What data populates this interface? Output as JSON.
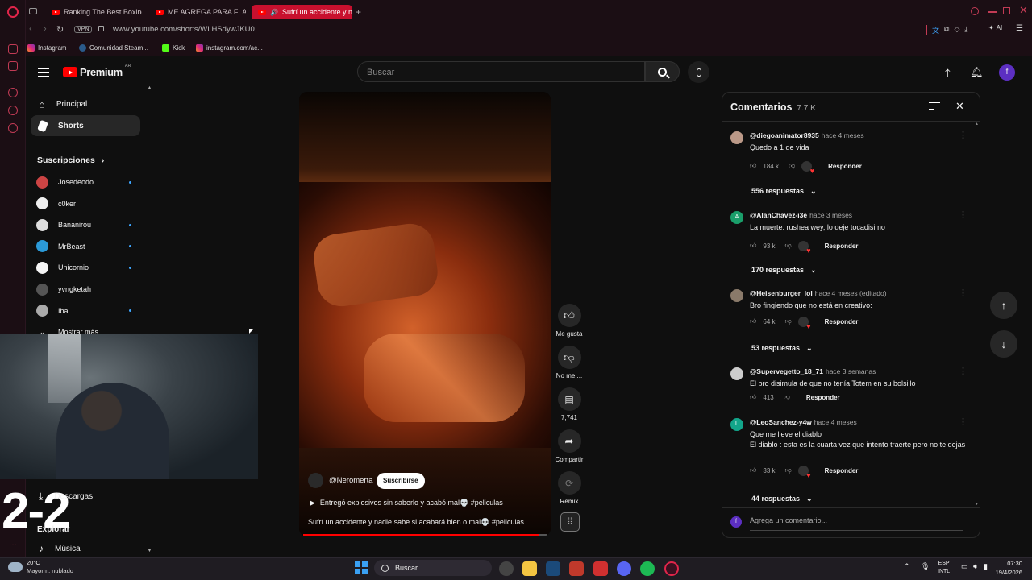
{
  "browser": {
    "tabs": [
      {
        "label": "Ranking The Best Boxing h"
      },
      {
        "label": "ME AGREGA PARA FLAME"
      },
      {
        "label": "Sufrí un accidente y n"
      }
    ],
    "vpn": "VPN",
    "url": "www.youtube.com/shorts/WLHSdywJKU0",
    "ai_label": "AI",
    "bookmarks": [
      "Instagram",
      "Comunidad Steam...",
      "Kick",
      "instagram.com/ac..."
    ]
  },
  "youtube": {
    "logo": "Premium",
    "logo_region": "AR",
    "search_placeholder": "Buscar",
    "avatar_letter": "f",
    "sidebar": {
      "main": [
        {
          "label": "Principal"
        },
        {
          "label": "Shorts"
        }
      ],
      "subs_title": "Suscripciones",
      "subs": [
        {
          "label": "Josedeodo",
          "color": "#c44"
        },
        {
          "label": "c0ker",
          "color": "#eee"
        },
        {
          "label": "Bananirou",
          "color": "#ddd"
        },
        {
          "label": "MrBeast",
          "color": "#2b9ad8"
        },
        {
          "label": "Unicornio",
          "color": "#f5f5f5"
        },
        {
          "label": "yvngketah",
          "color": "#555"
        },
        {
          "label": "Ibai",
          "color": "#aaa"
        }
      ],
      "show_more": "Mostrar más",
      "downloads": "Descargas",
      "explore": "Explorar",
      "music": "Música"
    },
    "overlay_score": "2-2",
    "short": {
      "channel": "@Neromerta",
      "subscribe": "Suscribirse",
      "playlist": "Entregó explosivos sin saberlo y acabó mal💀 #peliculas",
      "title": "Sufrí un accidente y nadie sabe si acabará bien o mal💀 #peliculas ...",
      "progress": 0.97,
      "actions": {
        "like": "Me gusta",
        "dislike": "No me ...",
        "comments": "7,741",
        "share": "Compartir",
        "remix": "Remix"
      }
    },
    "comments": {
      "title": "Comentarios",
      "count": "7.7 K",
      "input_placeholder": "Agrega un comentario...",
      "reply_label": "Responder",
      "items": [
        {
          "author": "@diegoanimator8935",
          "time": "hace 4 meses",
          "text": "Quedo a 1 de vida",
          "likes": "184 k",
          "replies": "556 respuestas",
          "avatar_color": "#b98",
          "hearted": true
        },
        {
          "author": "@AlanChavez-i3e",
          "time": "hace 3 meses",
          "text": "La muerte: rushea wey, lo deje tocadisimo",
          "likes": "93 k",
          "replies": "170 respuestas",
          "avatar_color": "#1a9e6a",
          "avatar_letter": "A",
          "hearted": true
        },
        {
          "author": "@Heisenburger_lol",
          "time": "hace 4 meses (editado)",
          "text": "Bro fingiendo que no está en creativo:",
          "likes": "64 k",
          "replies": "53 respuestas",
          "avatar_color": "#8a7a6a",
          "hearted": true
        },
        {
          "author": "@Supervegetto_18_71",
          "time": "hace 3 semanas",
          "text": "El bro disimula de que no tenía Totem en su bolsillo",
          "likes": "413",
          "replies": "",
          "avatar_color": "#ccc",
          "hearted": false
        },
        {
          "author": "@LeoSanchez-y4w",
          "time": "hace 4 meses",
          "text": "Que me lleve el diablo\nEl diablo : esta es la cuarta vez que intento traerte pero no te dejas",
          "likes": "33 k",
          "replies": "44 respuestas",
          "avatar_color": "#12a58a",
          "avatar_letter": "L",
          "hearted": true
        }
      ]
    }
  },
  "taskbar": {
    "weather_temp": "20°C",
    "weather_desc": "Mayorm. nublado",
    "search": "Buscar",
    "lang": "ESP",
    "lang2": "INTL",
    "time": "07:30",
    "date": "19/4/2026"
  }
}
